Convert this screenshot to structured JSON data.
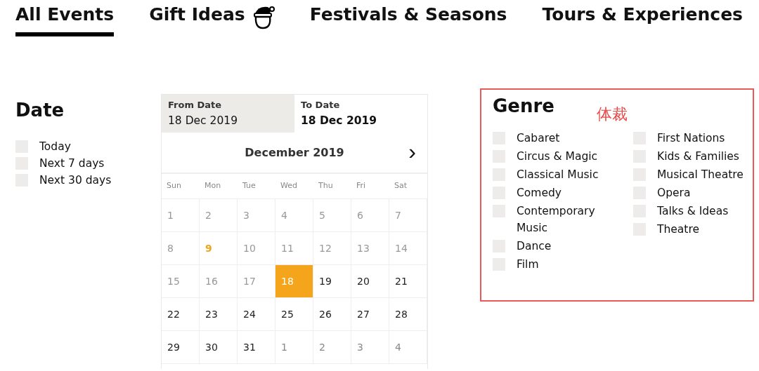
{
  "tabs": [
    {
      "label": "All Events",
      "selected": true,
      "kind": "plain"
    },
    {
      "label": "Gift Ideas",
      "selected": false,
      "kind": "santa"
    },
    {
      "label": "Festivals & Seasons",
      "selected": false,
      "kind": "plain"
    },
    {
      "label": "Tours & Experiences",
      "selected": false,
      "kind": "plain"
    }
  ],
  "date_filter": {
    "title": "Date",
    "options": [
      {
        "label": "Today",
        "checked": false
      },
      {
        "label": "Next 7 days",
        "checked": false
      },
      {
        "label": "Next 30 days",
        "checked": false
      }
    ]
  },
  "calendar": {
    "from": {
      "label": "From Date",
      "value": "18 Dec 2019",
      "selected": true
    },
    "to": {
      "label": "To Date",
      "value": "18 Dec 2019",
      "selected": false
    },
    "month": "December 2019",
    "next": "›",
    "weekdays": [
      "Sun",
      "Mon",
      "Tue",
      "Wed",
      "Thu",
      "Fri",
      "Sat"
    ],
    "days": [
      {
        "label": "1",
        "kind": "past",
        "selected": false
      },
      {
        "label": "2",
        "kind": "past",
        "selected": false
      },
      {
        "label": "3",
        "kind": "past",
        "selected": false
      },
      {
        "label": "4",
        "kind": "past",
        "selected": false
      },
      {
        "label": "5",
        "kind": "past",
        "selected": false
      },
      {
        "label": "6",
        "kind": "past",
        "selected": false
      },
      {
        "label": "7",
        "kind": "past",
        "selected": false
      },
      {
        "label": "8",
        "kind": "past",
        "selected": false
      },
      {
        "label": "9",
        "kind": "today",
        "selected": false
      },
      {
        "label": "10",
        "kind": "past",
        "selected": false
      },
      {
        "label": "11",
        "kind": "past",
        "selected": false
      },
      {
        "label": "12",
        "kind": "past",
        "selected": false
      },
      {
        "label": "13",
        "kind": "past",
        "selected": false
      },
      {
        "label": "14",
        "kind": "past",
        "selected": false
      },
      {
        "label": "15",
        "kind": "past",
        "selected": false
      },
      {
        "label": "16",
        "kind": "past",
        "selected": false
      },
      {
        "label": "17",
        "kind": "past",
        "selected": false
      },
      {
        "label": "18",
        "kind": "future",
        "selected": true
      },
      {
        "label": "19",
        "kind": "future",
        "selected": false
      },
      {
        "label": "20",
        "kind": "future",
        "selected": false
      },
      {
        "label": "21",
        "kind": "future",
        "selected": false
      },
      {
        "label": "22",
        "kind": "future",
        "selected": false
      },
      {
        "label": "23",
        "kind": "future",
        "selected": false
      },
      {
        "label": "24",
        "kind": "future",
        "selected": false
      },
      {
        "label": "25",
        "kind": "future",
        "selected": false
      },
      {
        "label": "26",
        "kind": "future",
        "selected": false
      },
      {
        "label": "27",
        "kind": "future",
        "selected": false
      },
      {
        "label": "28",
        "kind": "future",
        "selected": false
      },
      {
        "label": "29",
        "kind": "future",
        "selected": false
      },
      {
        "label": "30",
        "kind": "future",
        "selected": false
      },
      {
        "label": "31",
        "kind": "future",
        "selected": false
      },
      {
        "label": "1",
        "kind": "other",
        "selected": false
      },
      {
        "label": "2",
        "kind": "other",
        "selected": false
      },
      {
        "label": "3",
        "kind": "other",
        "selected": false
      },
      {
        "label": "4",
        "kind": "other",
        "selected": false
      }
    ]
  },
  "genre_filter": {
    "title": "Genre",
    "annotation": "体裁",
    "columns": [
      [
        {
          "label": "Cabaret",
          "checked": false
        },
        {
          "label": "Circus & Magic",
          "checked": false
        },
        {
          "label": "Classical Music",
          "checked": false
        },
        {
          "label": "Comedy",
          "checked": false
        },
        {
          "label": "Contemporary Music",
          "checked": false
        },
        {
          "label": "Dance",
          "checked": false
        },
        {
          "label": "Film",
          "checked": false
        }
      ],
      [
        {
          "label": "First Nations",
          "checked": false
        },
        {
          "label": "Kids & Families",
          "checked": false
        },
        {
          "label": "Musical Theatre",
          "checked": false
        },
        {
          "label": "Opera",
          "checked": false
        },
        {
          "label": "Talks & Ideas",
          "checked": false
        },
        {
          "label": "Theatre",
          "checked": false
        }
      ]
    ]
  }
}
